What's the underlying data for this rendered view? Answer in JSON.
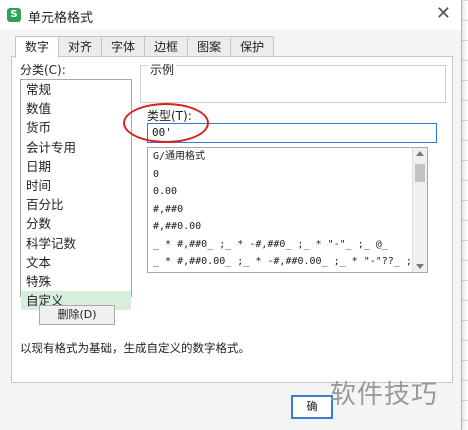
{
  "window": {
    "title": "单元格格式",
    "app_icon": "S"
  },
  "tabs": [
    {
      "label": "数字",
      "active": true
    },
    {
      "label": "对齐"
    },
    {
      "label": "字体"
    },
    {
      "label": "边框"
    },
    {
      "label": "图案"
    },
    {
      "label": "保护"
    }
  ],
  "category": {
    "label": "分类(C):",
    "items": [
      "常规",
      "数值",
      "货币",
      "会计专用",
      "日期",
      "时间",
      "百分比",
      "分数",
      "科学记数",
      "文本",
      "特殊",
      "自定义"
    ],
    "selected": "自定义"
  },
  "sample": {
    "label": "示例"
  },
  "type": {
    "label": "类型(T):",
    "value": "00'"
  },
  "formats": [
    "G/通用格式",
    "0",
    "0.00",
    "#,##0",
    "#,##0.00",
    "_ * #,##0_ ;_ * -#,##0_ ;_ * \"-\"_ ;_ @_",
    "_ * #,##0.00_ ;_ * -#,##0.00_ ;_ * \"-\"??_ ;"
  ],
  "buttons": {
    "delete": "删除(D)",
    "ok": "确"
  },
  "description": "以现有格式为基础，生成自定义的数字格式。",
  "watermark": "软件技巧",
  "colors": {
    "annotation": "#d8221e",
    "selected_category": "#d8eedd",
    "focus": "#2e7bd1",
    "icon": "#2fa15a"
  }
}
